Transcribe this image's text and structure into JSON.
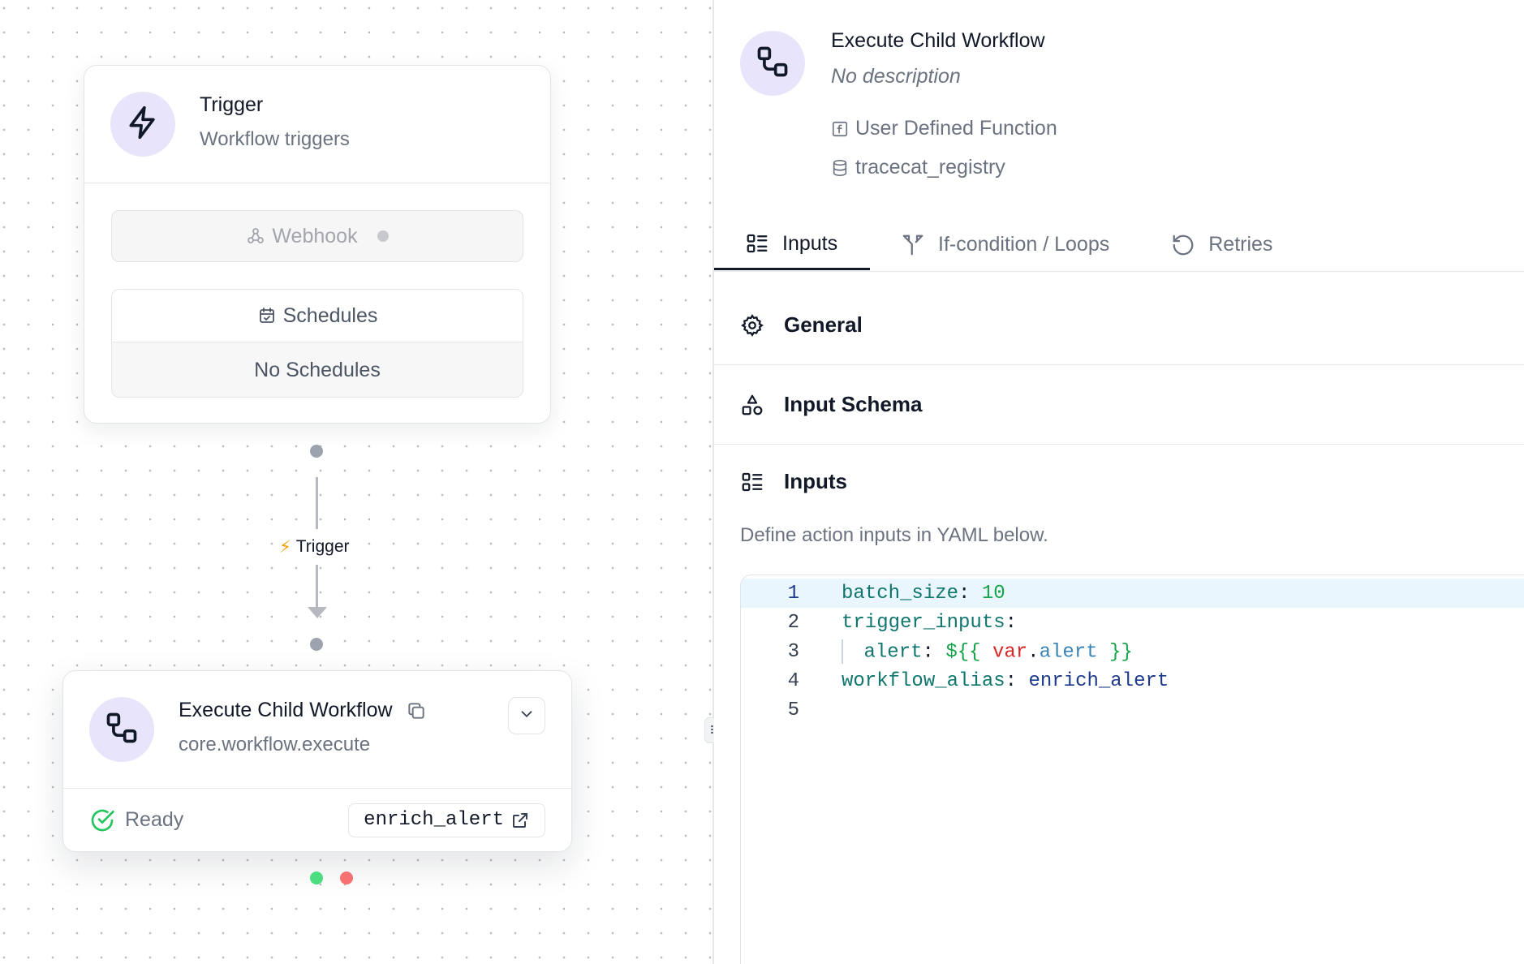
{
  "canvas": {
    "trigger_node": {
      "title": "Trigger",
      "subtitle": "Workflow triggers",
      "webhook_label": "Webhook",
      "schedules_label": "Schedules",
      "schedules_empty": "No Schedules"
    },
    "edge": {
      "label_icon": "⚡",
      "label": "Trigger"
    },
    "child_node": {
      "title": "Execute Child Workflow",
      "subtitle": "core.workflow.execute",
      "status": "Ready",
      "alias": "enrich_alert"
    },
    "colors": {
      "success_handle": "#4ade80",
      "error_handle": "#f87171",
      "accent": "#e8e4fb"
    }
  },
  "panel": {
    "title": "Execute Child Workflow",
    "description": "No description",
    "meta": [
      {
        "icon": "function-icon",
        "label": "User Defined Function"
      },
      {
        "icon": "database-icon",
        "label": "tracecat_registry"
      }
    ],
    "tabs": [
      {
        "label": "Inputs",
        "active": true
      },
      {
        "label": "If-condition / Loops",
        "active": false
      },
      {
        "label": "Retries",
        "active": false
      }
    ],
    "sections": {
      "general": "General",
      "input_schema": "Input Schema",
      "inputs": "Inputs",
      "inputs_description": "Define action inputs in YAML below."
    },
    "editor": {
      "line_numbers": [
        "1",
        "2",
        "3",
        "4",
        "5"
      ],
      "lines": {
        "l1_key": "batch_size",
        "l1_colon": ":",
        "l1_value": "10",
        "l2_key": "trigger_inputs",
        "l2_colon": ":",
        "l3_key": "alert",
        "l3_colon": ":",
        "l3_open": "${{",
        "l3_var": "var",
        "l3_dot": ".",
        "l3_member": "alert",
        "l3_close": "}}",
        "l4_key": "workflow_alias",
        "l4_colon": ":",
        "l4_value": "enrich_alert"
      }
    }
  }
}
